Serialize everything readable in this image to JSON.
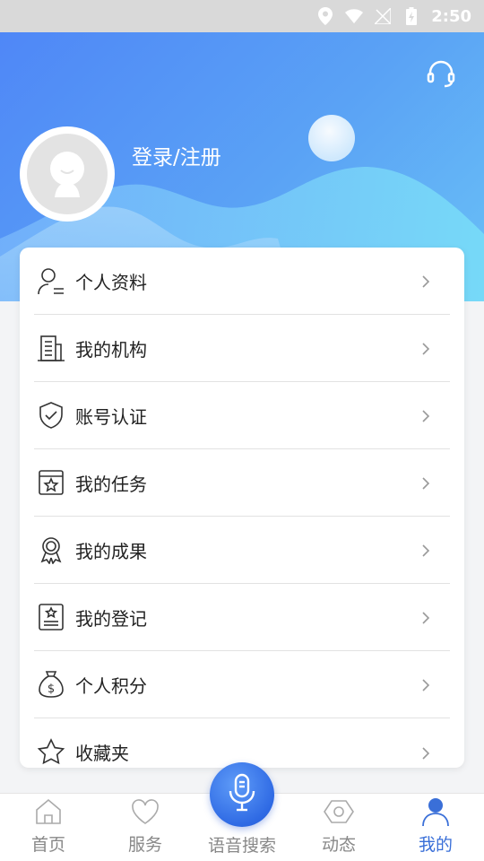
{
  "status_bar": {
    "time": "2:50"
  },
  "header": {
    "login_label": "登录/注册"
  },
  "menu": [
    {
      "label": "个人资料",
      "icon": "user-profile-icon"
    },
    {
      "label": "我的机构",
      "icon": "building-icon"
    },
    {
      "label": "账号认证",
      "icon": "shield-check-icon"
    },
    {
      "label": "我的任务",
      "icon": "task-star-icon"
    },
    {
      "label": "我的成果",
      "icon": "award-icon"
    },
    {
      "label": "我的登记",
      "icon": "register-icon"
    },
    {
      "label": "个人积分",
      "icon": "money-bag-icon"
    },
    {
      "label": "收藏夹",
      "icon": "star-icon"
    }
  ],
  "bottom_nav": {
    "home": "首页",
    "service": "服务",
    "voice_search": "语音搜索",
    "dynamic": "动态",
    "mine": "我的"
  },
  "colors": {
    "primary": "#3a6fd8",
    "header_start": "#4f87f7",
    "header_end": "#69c0f6"
  }
}
